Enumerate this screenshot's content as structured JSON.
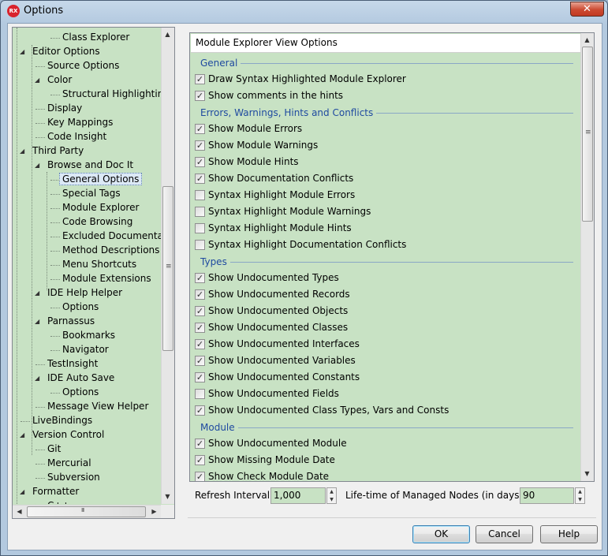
{
  "window": {
    "title": "Options",
    "app_icon": "rx-logo-icon",
    "close_label": "✕"
  },
  "tree": {
    "items": [
      {
        "label": "Class Explorer",
        "level": 3,
        "expander": ""
      },
      {
        "label": "Editor Options",
        "level": 1,
        "expander": "◢"
      },
      {
        "label": "Source Options",
        "level": 2,
        "expander": ""
      },
      {
        "label": "Color",
        "level": 2,
        "expander": "◢"
      },
      {
        "label": "Structural Highlighting",
        "level": 3,
        "expander": ""
      },
      {
        "label": "Display",
        "level": 2,
        "expander": ""
      },
      {
        "label": "Key Mappings",
        "level": 2,
        "expander": ""
      },
      {
        "label": "Code Insight",
        "level": 2,
        "expander": ""
      },
      {
        "label": "Third Party",
        "level": 1,
        "expander": "◢"
      },
      {
        "label": "Browse and Doc It",
        "level": 2,
        "expander": "◢"
      },
      {
        "label": "General Options",
        "level": 3,
        "expander": "",
        "selected": true
      },
      {
        "label": "Special Tags",
        "level": 3,
        "expander": ""
      },
      {
        "label": "Module Explorer",
        "level": 3,
        "expander": ""
      },
      {
        "label": "Code Browsing",
        "level": 3,
        "expander": ""
      },
      {
        "label": "Excluded Documentatio",
        "level": 3,
        "expander": ""
      },
      {
        "label": "Method Descriptions",
        "level": 3,
        "expander": ""
      },
      {
        "label": "Menu Shortcuts",
        "level": 3,
        "expander": ""
      },
      {
        "label": "Module Extensions",
        "level": 3,
        "expander": ""
      },
      {
        "label": "IDE Help Helper",
        "level": 2,
        "expander": "◢"
      },
      {
        "label": "Options",
        "level": 3,
        "expander": ""
      },
      {
        "label": "Parnassus",
        "level": 2,
        "expander": "◢"
      },
      {
        "label": "Bookmarks",
        "level": 3,
        "expander": ""
      },
      {
        "label": "Navigator",
        "level": 3,
        "expander": ""
      },
      {
        "label": "TestInsight",
        "level": 2,
        "expander": ""
      },
      {
        "label": "IDE Auto Save",
        "level": 2,
        "expander": "◢"
      },
      {
        "label": "Options",
        "level": 3,
        "expander": ""
      },
      {
        "label": "Message View Helper",
        "level": 2,
        "expander": ""
      },
      {
        "label": "LiveBindings",
        "level": 1,
        "expander": ""
      },
      {
        "label": "Version Control",
        "level": 1,
        "expander": "◢"
      },
      {
        "label": "Git",
        "level": 2,
        "expander": ""
      },
      {
        "label": "Mercurial",
        "level": 2,
        "expander": ""
      },
      {
        "label": "Subversion",
        "level": 2,
        "expander": ""
      },
      {
        "label": "Formatter",
        "level": 1,
        "expander": "◢"
      },
      {
        "label": "C++",
        "level": 2,
        "expander": "▷"
      }
    ],
    "vscroll": {
      "up": "▲",
      "down": "▼",
      "grip": "≡"
    },
    "hscroll": {
      "left": "◀",
      "right": "▶",
      "grip": "III"
    }
  },
  "pane": {
    "title": "Module Explorer View Options",
    "groups": [
      {
        "name": "General",
        "options": [
          {
            "label": "Draw Syntax Highlighted Module Explorer",
            "checked": true
          },
          {
            "label": "Show comments in the hints",
            "checked": true
          }
        ]
      },
      {
        "name": "Errors, Warnings, Hints and Conflicts",
        "options": [
          {
            "label": "Show Module Errors",
            "checked": true
          },
          {
            "label": "Show Module Warnings",
            "checked": true
          },
          {
            "label": "Show Module Hints",
            "checked": true
          },
          {
            "label": "Show Documentation Conflicts",
            "checked": true
          },
          {
            "label": "Syntax Highlight Module Errors",
            "checked": false
          },
          {
            "label": "Syntax Highlight Module Warnings",
            "checked": false
          },
          {
            "label": "Syntax Highlight Module Hints",
            "checked": false
          },
          {
            "label": "Syntax Highlight Documentation Conflicts",
            "checked": false
          }
        ]
      },
      {
        "name": "Types",
        "options": [
          {
            "label": "Show Undocumented Types",
            "checked": true
          },
          {
            "label": "Show Undocumented Records",
            "checked": true
          },
          {
            "label": "Show Undocumented Objects",
            "checked": true
          },
          {
            "label": "Show Undocumented Classes",
            "checked": true
          },
          {
            "label": "Show Undocumented Interfaces",
            "checked": true
          },
          {
            "label": "Show Undocumented Variables",
            "checked": true
          },
          {
            "label": "Show Undocumented Constants",
            "checked": true
          },
          {
            "label": "Show Undocumented Fields",
            "checked": false
          },
          {
            "label": "Show Undocumented Class Types, Vars and Consts",
            "checked": true
          }
        ]
      },
      {
        "name": "Module",
        "options": [
          {
            "label": "Show Undocumented Module",
            "checked": true
          },
          {
            "label": "Show Missing Module Date",
            "checked": true
          },
          {
            "label": "Show Check Module Date",
            "checked": true
          }
        ]
      }
    ],
    "check_glyph": "✓",
    "vscroll": {
      "up": "▲",
      "down": "▼",
      "grip": "≡"
    }
  },
  "refresh": {
    "label": "Refresh Interval",
    "value": "1,000"
  },
  "lifetime": {
    "label": "Life-time of Managed Nodes (in days)",
    "value": "90"
  },
  "spin": {
    "up": "▲",
    "down": "▼"
  },
  "buttons": {
    "ok": "OK",
    "cancel": "Cancel",
    "help": "Help"
  },
  "colors": {
    "field_bg": "#c8e2c4",
    "group_header": "#1f4aa0",
    "close_button": "#cc4a31"
  }
}
